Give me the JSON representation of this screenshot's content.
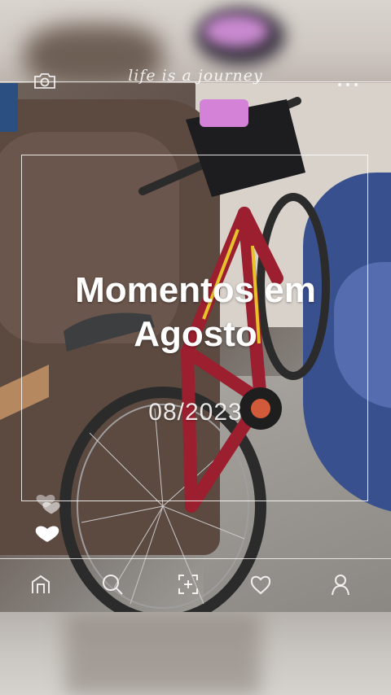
{
  "header": {
    "tagline": "life is a journey"
  },
  "card": {
    "title": "Momentos em Agosto",
    "date": "08/2023"
  },
  "nav": {
    "items": [
      {
        "name": "home",
        "icon": "home-icon"
      },
      {
        "name": "search",
        "icon": "search-icon"
      },
      {
        "name": "add",
        "icon": "add-photo-icon"
      },
      {
        "name": "likes",
        "icon": "heart-icon"
      },
      {
        "name": "profile",
        "icon": "profile-icon"
      }
    ]
  },
  "colors": {
    "overlay_text": "#ffffff",
    "bike_frame": "#9b1f2e",
    "bike_accent": "#e7c22a",
    "car": "#39508f"
  }
}
